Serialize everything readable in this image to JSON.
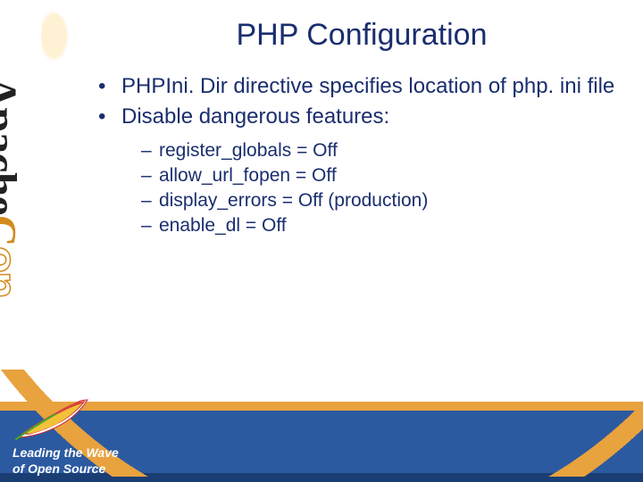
{
  "title": "PHP Configuration",
  "bullets": [
    "PHPIni. Dir directive specifies location of php. ini file",
    "Disable dangerous features:"
  ],
  "sub_bullets": [
    "register_globals = Off",
    "allow_url_fopen = Off",
    "display_errors = Off (production)",
    "enable_dl = Off"
  ],
  "brand": {
    "apache": "Apache",
    "con_c": "C",
    "con_on": "on"
  },
  "tagline_l1": "Leading the Wave",
  "tagline_l2": "of Open Source"
}
